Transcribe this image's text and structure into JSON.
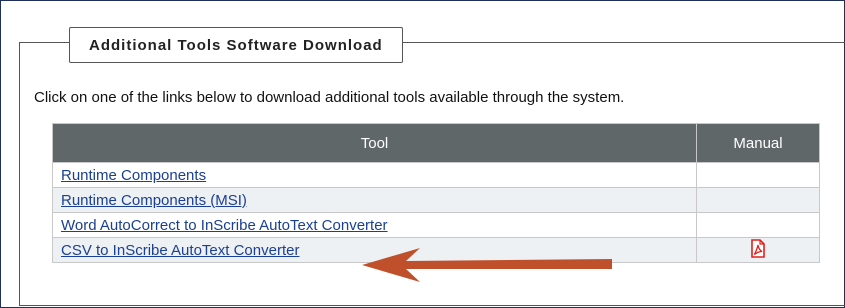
{
  "section": {
    "legend": "Additional Tools Software Download",
    "intro": "Click on one of the links below to download additional tools available through the system."
  },
  "table": {
    "headers": {
      "tool": "Tool",
      "manual": "Manual"
    },
    "rows": [
      {
        "tool": "Runtime Components",
        "manual_icon": ""
      },
      {
        "tool": "Runtime Components (MSI)",
        "manual_icon": ""
      },
      {
        "tool": "Word AutoCorrect to InScribe AutoText Converter",
        "manual_icon": ""
      },
      {
        "tool": "CSV to InScribe AutoText Converter",
        "manual_icon": "pdf-icon"
      }
    ]
  },
  "colors": {
    "header_bg": "#5f6769",
    "link": "#1b3f93",
    "arrow": "#c0502c",
    "pdf_icon": "#e0201b"
  }
}
